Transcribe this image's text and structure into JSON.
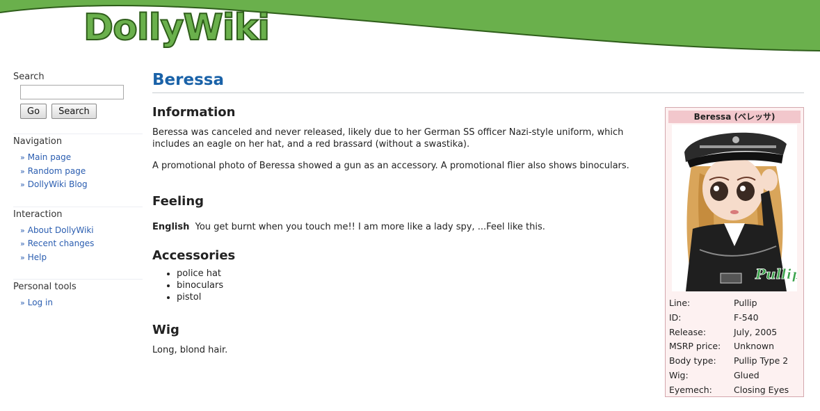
{
  "site": {
    "logo": "DollyWiki"
  },
  "sidebar": {
    "search": {
      "heading": "Search",
      "input_value": "",
      "go_label": "Go",
      "search_label": "Search"
    },
    "navigation": {
      "heading": "Navigation",
      "items": [
        {
          "label": "Main page"
        },
        {
          "label": "Random page"
        },
        {
          "label": "DollyWiki Blog"
        }
      ]
    },
    "interaction": {
      "heading": "Interaction",
      "items": [
        {
          "label": "About DollyWiki"
        },
        {
          "label": "Recent changes"
        },
        {
          "label": "Help"
        }
      ]
    },
    "personal_tools": {
      "heading": "Personal tools",
      "items": [
        {
          "label": "Log in"
        }
      ]
    }
  },
  "article": {
    "title": "Beressa",
    "information": {
      "heading": "Information",
      "p1": "Beressa was canceled and never released, likely due to her German SS officer Nazi-style uniform, which includes an eagle on her hat, and a red brassard (without a swastika).",
      "p2": "A promotional photo of Beressa showed a gun as an accessory. A promotional flier also shows binoculars."
    },
    "feeling": {
      "heading": "Feeling",
      "lang": "English",
      "text": "You get burnt when you touch me!! I am more like a lady spy, ...Feel like this."
    },
    "accessories": {
      "heading": "Accessories",
      "items": [
        "police hat",
        "binoculars",
        "pistol"
      ]
    },
    "wig": {
      "heading": "Wig",
      "text": "Long, blond hair."
    }
  },
  "infobox": {
    "title": "Beressa (ベレッサ)",
    "image_brand": "Pullip",
    "rows": [
      {
        "key": "Line:",
        "value": "Pullip"
      },
      {
        "key": "ID:",
        "value": "F-540"
      },
      {
        "key": "Release:",
        "value": "July, 2005"
      },
      {
        "key": "MSRP price:",
        "value": "Unknown"
      },
      {
        "key": "Body type:",
        "value": "Pullip Type 2"
      },
      {
        "key": "Wig:",
        "value": "Glued"
      },
      {
        "key": "Eyemech:",
        "value": "Closing Eyes"
      }
    ]
  },
  "colors": {
    "header_green": "#6ab04c",
    "title_blue": "#1a62a8",
    "link_blue": "#2a5db0",
    "infobox_bg": "#fdf1f1",
    "infobox_title_bg": "#f2c7cc"
  }
}
